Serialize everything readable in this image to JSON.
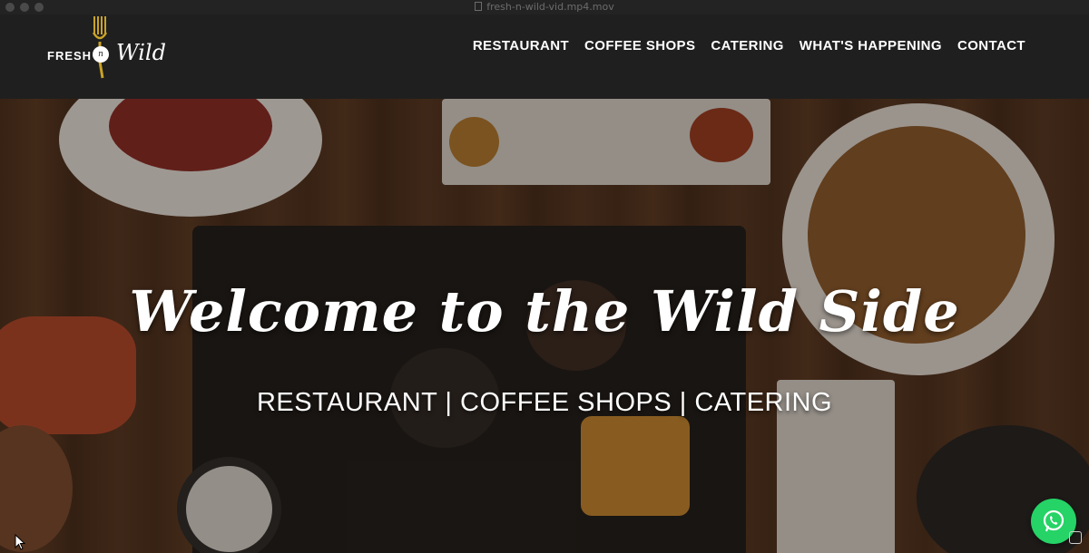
{
  "window": {
    "title": "fresh-n-wild-vid.mp4.mov"
  },
  "logo": {
    "fresh": "FRESH",
    "n": "n",
    "wild": "Wild"
  },
  "nav": {
    "items": [
      "RESTAURANT",
      "COFFEE SHOPS",
      "CATERING",
      "WHAT'S HAPPENING",
      "CONTACT"
    ]
  },
  "hero": {
    "title": "Welcome to the Wild Side",
    "subtitle": "RESTAURANT | COFFEE SHOPS | CATERING"
  },
  "colors": {
    "header_bg": "#1f1f1f",
    "accent_gold": "#c9a227",
    "whatsapp_green": "#25d366"
  },
  "icons": {
    "whatsapp": "whatsapp-icon",
    "logo_fork": "fork-icon"
  }
}
